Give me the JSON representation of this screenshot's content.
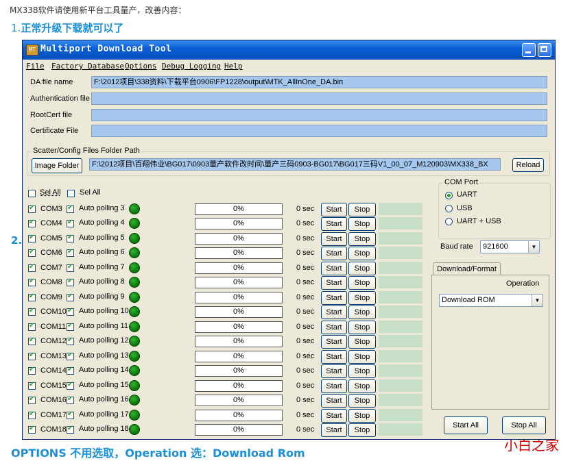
{
  "doc": {
    "intro": "MX338软件请使用新平台工具量产，改善内容：",
    "step1_num": "1.",
    "step1_text": "正常升级下载就可以了",
    "step2_num": "2.",
    "bottom_note": "OPTIONS 不用选取，Operation 选：Download Rom",
    "watermark": "小白之家"
  },
  "window": {
    "title": "Multiport Download Tool",
    "menu": [
      {
        "label": "File"
      },
      {
        "label": "Factory Database"
      },
      {
        "label": "Options"
      },
      {
        "label": "Debug Logging"
      },
      {
        "label": "Help"
      }
    ],
    "da_file_label": "DA file name",
    "da_file_value": "F:\\2012项目\\338资料\\下载平台0906\\FP1228\\output\\MTK_AllInOne_DA.bin",
    "auth_file_label": "Authentication file",
    "auth_file_value": "",
    "rootcert_label": "RootCert file",
    "rootcert_value": "",
    "cert_label": "Certificate File",
    "cert_value": "",
    "scatter_group_title": "Scatter/Config Files Folder Path",
    "image_folder_button": "Image Folder",
    "scatter_path": "F:\\2012项目\\百翔伟业\\BG017\\0903量产软件改时间\\量产三码0903-BG017\\BG017三码V1_00_07_M120903\\MX338_BX",
    "reload_button": "Reload",
    "sel_all_1": "Sel All",
    "sel_all_2": "Sel All",
    "start_label": "Start",
    "stop_label": "Stop",
    "ports": [
      {
        "com": "COM3",
        "polling": "Auto polling 3",
        "progress": "0%",
        "time": "0 sec"
      },
      {
        "com": "COM4",
        "polling": "Auto polling 4",
        "progress": "0%",
        "time": "0 sec"
      },
      {
        "com": "COM5",
        "polling": "Auto polling 5",
        "progress": "0%",
        "time": "0 sec"
      },
      {
        "com": "COM6",
        "polling": "Auto polling 6",
        "progress": "0%",
        "time": "0 sec"
      },
      {
        "com": "COM7",
        "polling": "Auto polling 7",
        "progress": "0%",
        "time": "0 sec"
      },
      {
        "com": "COM8",
        "polling": "Auto polling 8",
        "progress": "0%",
        "time": "0 sec"
      },
      {
        "com": "COM9",
        "polling": "Auto polling 9",
        "progress": "0%",
        "time": "0 sec"
      },
      {
        "com": "COM10",
        "polling": "Auto polling 10",
        "progress": "0%",
        "time": "0 sec"
      },
      {
        "com": "COM11",
        "polling": "Auto polling 11",
        "progress": "0%",
        "time": "0 sec"
      },
      {
        "com": "COM12",
        "polling": "Auto polling 12",
        "progress": "0%",
        "time": "0 sec"
      },
      {
        "com": "COM13",
        "polling": "Auto polling 13",
        "progress": "0%",
        "time": "0 sec"
      },
      {
        "com": "COM14",
        "polling": "Auto polling 14",
        "progress": "0%",
        "time": "0 sec"
      },
      {
        "com": "COM15",
        "polling": "Auto polling 15",
        "progress": "0%",
        "time": "0 sec"
      },
      {
        "com": "COM16",
        "polling": "Auto polling 16",
        "progress": "0%",
        "time": "0 sec"
      },
      {
        "com": "COM17",
        "polling": "Auto polling 17",
        "progress": "0%",
        "time": "0 sec"
      },
      {
        "com": "COM18",
        "polling": "Auto polling 18",
        "progress": "0%",
        "time": "0 sec"
      }
    ],
    "com_port_title": "COM Port",
    "com_port_options": [
      "UART",
      "USB",
      "UART + USB"
    ],
    "com_port_selected": "UART",
    "baud_label": "Baud rate",
    "baud_value": "921600",
    "tab_label": "Download/Format",
    "operation_label": "Operation",
    "operation_value": "Download ROM",
    "start_all_button": "Start All",
    "stop_all_button": "Stop All",
    "colors": {
      "title_bar": "#0a5fd8",
      "field_bg": "#a6c8ee",
      "status_bg": "#c6dfc6",
      "led": "#1a8f1a",
      "doc_blue": "#1a8fd8",
      "watermark": "#d40000"
    }
  }
}
